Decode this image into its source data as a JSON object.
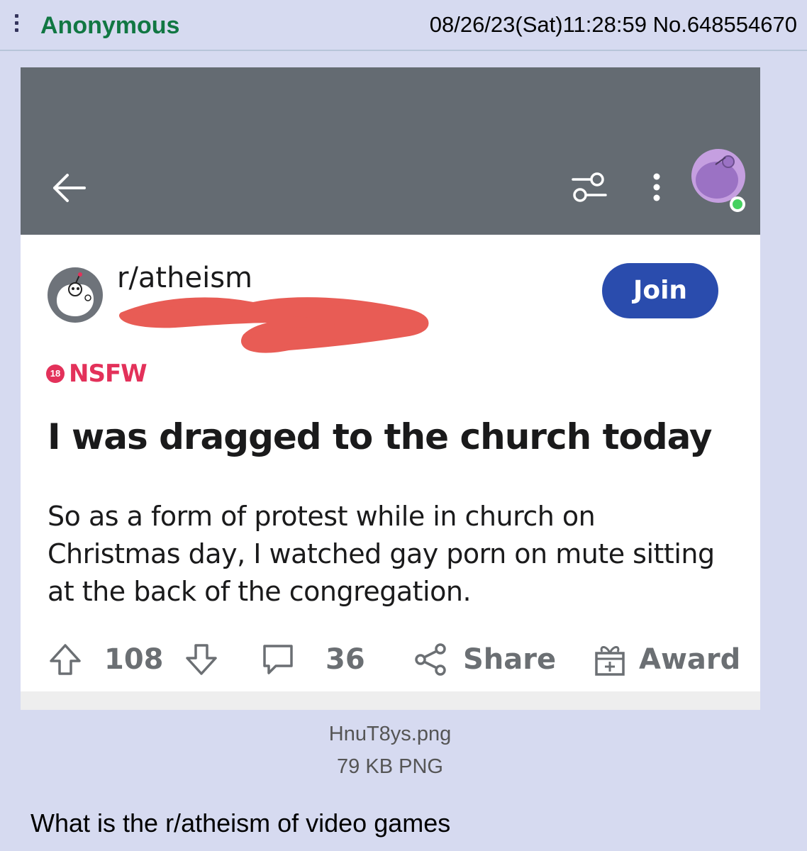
{
  "post": {
    "name": "Anonymous",
    "datetime": "08/26/23(Sat)11:28:59",
    "number": "No.648554670",
    "comment": "What is the r/atheism of video games"
  },
  "file": {
    "filename": "HnuT8ys.png",
    "size": "79 KB PNG"
  },
  "screenshot": {
    "subreddit": "r/atheism",
    "join_label": "Join",
    "nsfw_badge": "18",
    "nsfw_label": "NSFW",
    "title": "I was dragged to the church today",
    "body": "So as a form of protest while in church on Christmas day, I watched gay porn on mute sitting at the back of the congregation.",
    "upvotes": "108",
    "comments": "36",
    "share_label": "Share",
    "award_label": "Award",
    "colors": {
      "appbar": "#646b72",
      "join": "#2a4cad",
      "nsfw": "#e3315a",
      "redaction": "#e85c55",
      "online": "#46d160"
    },
    "icons": [
      "back-arrow-icon",
      "filter-icon",
      "kebab-menu-icon",
      "user-avatar",
      "snoo-icon",
      "upvote-icon",
      "downvote-icon",
      "comment-icon",
      "share-icon",
      "award-icon"
    ]
  }
}
